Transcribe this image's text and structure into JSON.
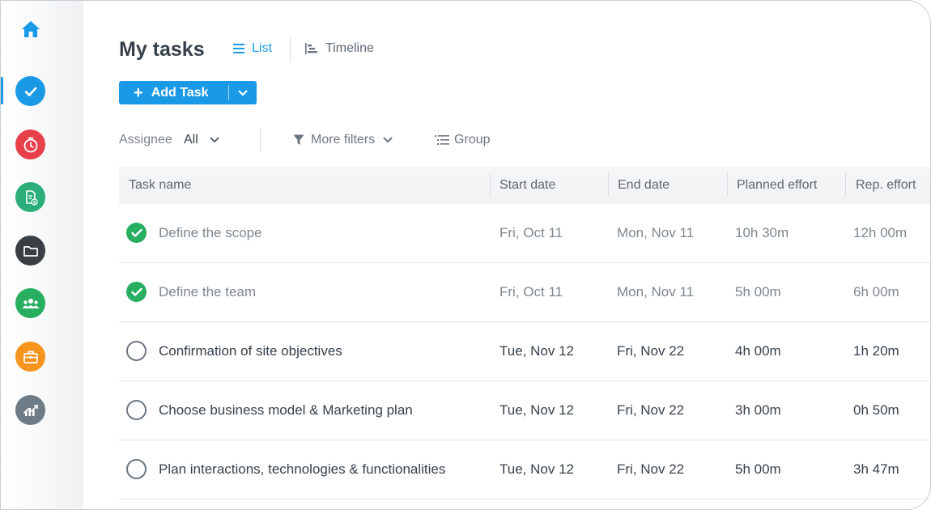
{
  "sidebar": {
    "items": [
      {
        "icon": "home-icon"
      },
      {
        "icon": "tasks-check-icon",
        "color": "#1a9ae6"
      },
      {
        "icon": "timer-icon",
        "color": "#e8404b"
      },
      {
        "icon": "invoice-icon",
        "color": "#2bae7a"
      },
      {
        "icon": "folder-icon",
        "color": "#3a3f44"
      },
      {
        "icon": "team-icon",
        "color": "#27ae60"
      },
      {
        "icon": "briefcase-icon",
        "color": "#f7941d"
      },
      {
        "icon": "reports-chart-icon",
        "color": "#6e7c88"
      }
    ]
  },
  "header": {
    "title": "My tasks",
    "tabs": [
      {
        "label": "List",
        "active": true
      },
      {
        "label": "Timeline",
        "active": false
      }
    ],
    "add_task_label": "Add Task"
  },
  "filters": {
    "assignee_label": "Assignee",
    "assignee_value": "All",
    "more_filters_label": "More filters",
    "group_label": "Group"
  },
  "table": {
    "columns": [
      "Task name",
      "Start date",
      "End date",
      "Planned effort",
      "Rep. effort"
    ],
    "rows": [
      {
        "name": "Define the scope",
        "start": "Fri, Oct 11",
        "end": "Mon, Nov 11",
        "planned": "10h 30m",
        "reported": "12h 00m",
        "done": true
      },
      {
        "name": "Define the team",
        "start": "Fri, Oct 11",
        "end": "Mon, Nov 11",
        "planned": "5h 00m",
        "reported": "6h 00m",
        "done": true
      },
      {
        "name": "Confirmation of site objectives",
        "start": "Tue, Nov 12",
        "end": "Fri, Nov 22",
        "planned": "4h 00m",
        "reported": "1h 20m",
        "done": false
      },
      {
        "name": "Choose business model & Marketing plan",
        "start": "Tue, Nov 12",
        "end": "Fri, Nov 22",
        "planned": "3h 00m",
        "reported": "0h 50m",
        "done": false
      },
      {
        "name": "Plan interactions, technologies & functionalities",
        "start": "Tue, Nov 12",
        "end": "Fri, Nov 22",
        "planned": "5h 00m",
        "reported": "3h 47m",
        "done": false
      }
    ]
  },
  "colors": {
    "accent": "#1a9ae6",
    "done_green": "#27ae60"
  }
}
